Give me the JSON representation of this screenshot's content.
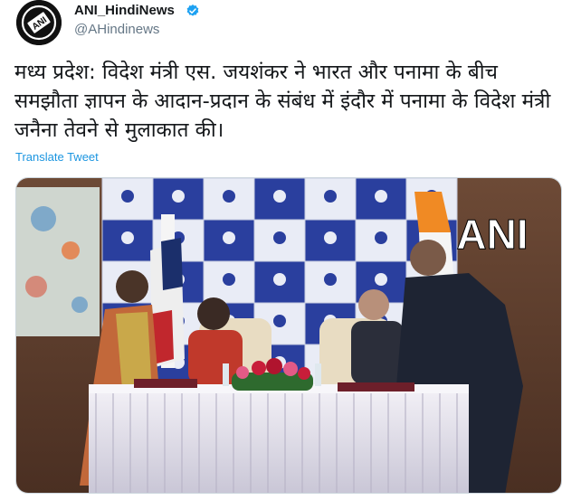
{
  "account": {
    "display_name": "ANI_HindiNews",
    "handle": "@AHindinews",
    "avatar_text": "ANI",
    "verified_icon": "verified-badge-icon"
  },
  "tweet": {
    "text": "मध्य प्रदेश: विदेश मंत्री एस. जयशंकर ने भारत और पनामा के बीच समझौता ज्ञापन के आदान-प्रदान के संबंध में इंदौर में पनामा के विदेश मंत्री जनैना तेवने से मुलाकात की।",
    "translate_label": "Translate Tweet"
  },
  "media": {
    "watermark": "ANI"
  },
  "colors": {
    "link": "#1b95e0",
    "verified": "#1da1f2",
    "backdrop_blue": "#2a3f9e"
  }
}
